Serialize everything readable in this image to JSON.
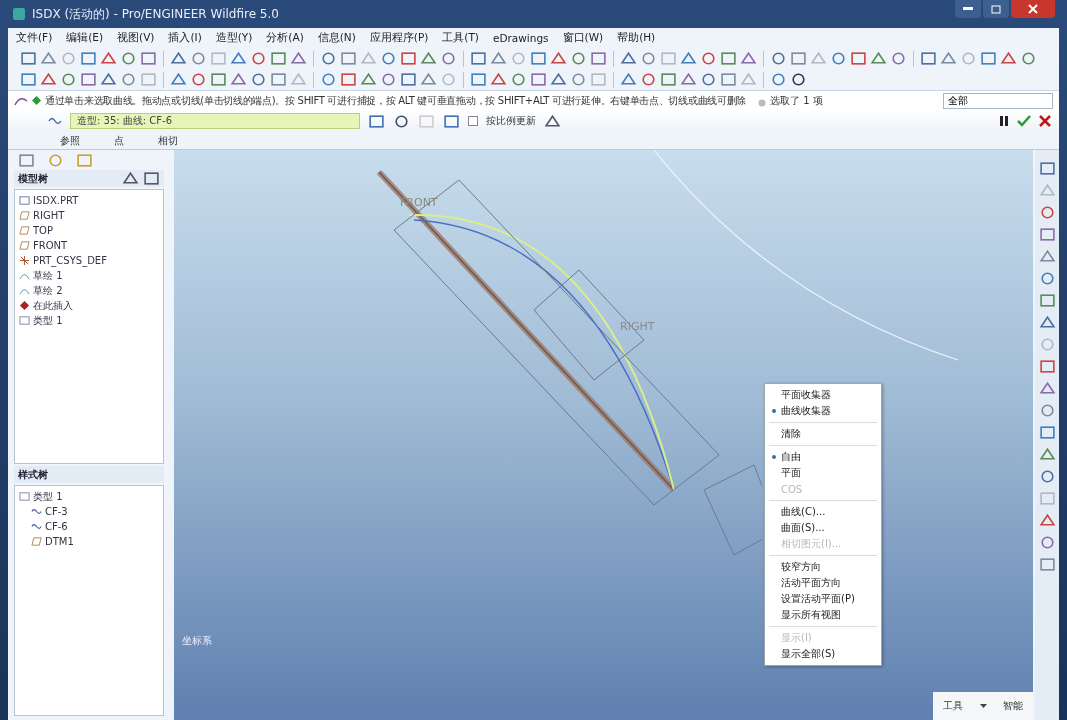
{
  "window": {
    "title": "ISDX (活动的) - Pro/ENGINEER Wildfire 5.0"
  },
  "menu": [
    "文件(F)",
    "编辑(E)",
    "视图(V)",
    "插入(I)",
    "造型(Y)",
    "分析(A)",
    "信息(N)",
    "应用程序(P)",
    "工具(T)",
    "eDrawings",
    "窗口(W)",
    "帮助(H)"
  ],
  "message": {
    "text": "通过单击来选取曲线。拖动点或切线(单击切线的端点)。按 SHIFT 可进行捕捉，按 ALT 键可垂直拖动，按 SHIFT+ALT 可进行延伸。右键单击点、切线或曲线可删除",
    "selection": "选取了 1 项",
    "filter": "全部"
  },
  "dashboard": {
    "feature": "造型: 35: 曲线: CF-6",
    "scale_update": {
      "label": "按比例更新",
      "checked": false
    },
    "tabs": [
      {
        "label": "参照",
        "selected": false
      },
      {
        "label": "点",
        "selected": false
      },
      {
        "label": "相切",
        "selected": false
      }
    ]
  },
  "model_tree": {
    "title": "模型树",
    "items": [
      {
        "label": "ISDX.PRT",
        "kind": "part"
      },
      {
        "label": "RIGHT",
        "kind": "plane"
      },
      {
        "label": "TOP",
        "kind": "plane"
      },
      {
        "label": "FRONT",
        "kind": "plane"
      },
      {
        "label": "PRT_CSYS_DEF",
        "kind": "csys"
      },
      {
        "label": "草绘 1",
        "kind": "sketch"
      },
      {
        "label": "草绘 2",
        "kind": "sketch"
      },
      {
        "label": "在此插入",
        "kind": "insert"
      },
      {
        "label": "类型 1",
        "kind": "style"
      }
    ]
  },
  "style_tree": {
    "title": "样式树",
    "items": [
      {
        "label": "类型 1",
        "kind": "style",
        "children": [
          {
            "label": "CF-3",
            "kind": "curve"
          },
          {
            "label": "CF-6",
            "kind": "curve"
          },
          {
            "label": "DTM1",
            "kind": "plane"
          }
        ]
      }
    ]
  },
  "canvas": {
    "labels": [
      "FRONT",
      "RIGHT"
    ],
    "note": "坐标系"
  },
  "context_menu": [
    [
      {
        "label": "平面收集器",
        "checked": false,
        "disabled": false
      },
      {
        "label": "曲线收集器",
        "checked": true,
        "disabled": false
      }
    ],
    [
      {
        "label": "清除",
        "checked": false,
        "disabled": false
      }
    ],
    [
      {
        "label": "自由",
        "checked": true,
        "disabled": false
      },
      {
        "label": "平面",
        "checked": false,
        "disabled": false
      },
      {
        "label": "COS",
        "checked": false,
        "disabled": true
      }
    ],
    [
      {
        "label": "曲线(C)...",
        "checked": false,
        "disabled": false
      },
      {
        "label": "曲面(S)...",
        "checked": false,
        "disabled": false
      },
      {
        "label": "相切图元(I)...",
        "checked": false,
        "disabled": true
      }
    ],
    [
      {
        "label": "较窄方向",
        "checked": false,
        "disabled": false
      },
      {
        "label": "活动平面方向",
        "checked": false,
        "disabled": false
      },
      {
        "label": "设置活动平面(P)",
        "checked": false,
        "disabled": false
      },
      {
        "label": "显示所有视图",
        "checked": false,
        "disabled": false
      }
    ],
    [
      {
        "label": "显示(I)",
        "checked": false,
        "disabled": true
      },
      {
        "label": "显示全部(S)",
        "checked": false,
        "disabled": false
      }
    ]
  ],
  "status": {
    "tools": "工具",
    "filter": "智能"
  }
}
